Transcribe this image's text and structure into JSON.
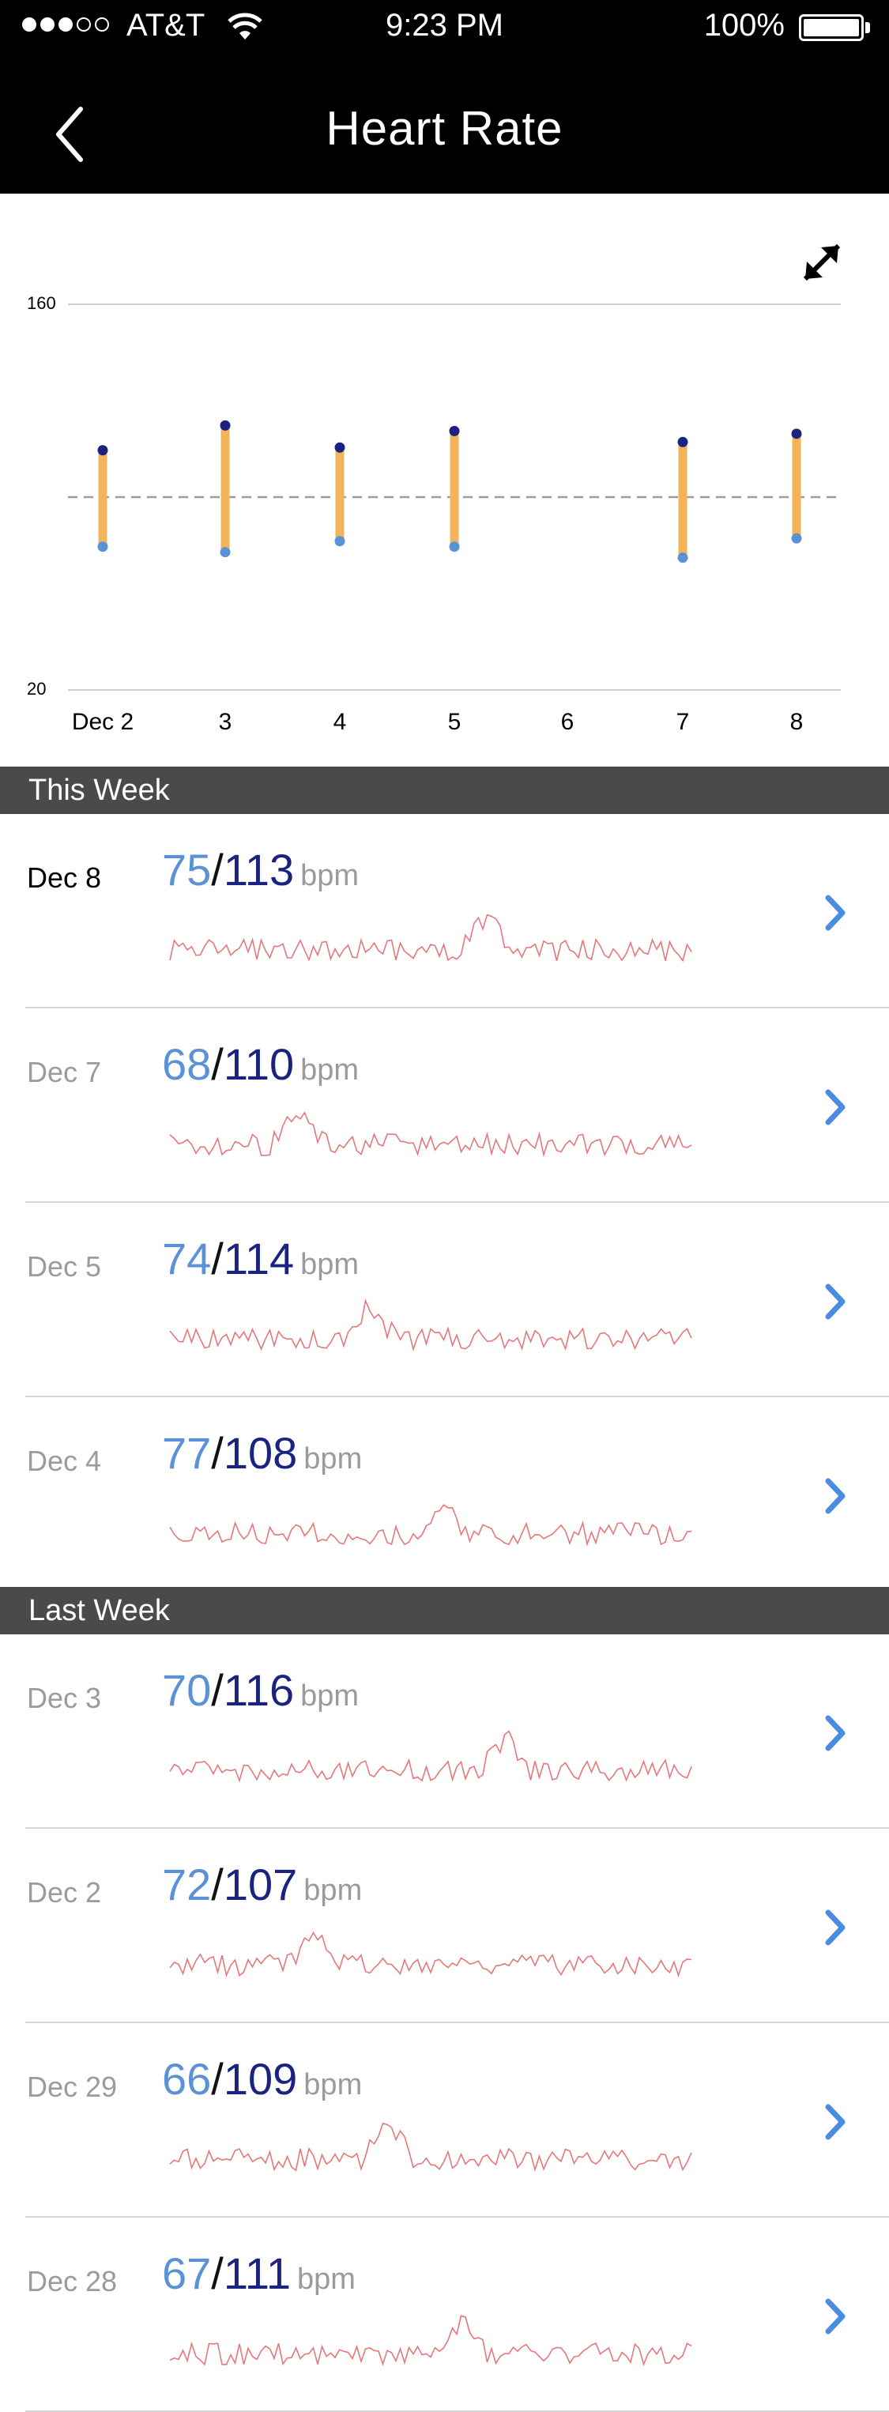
{
  "status_bar": {
    "carrier": "AT&T",
    "time": "9:23 PM",
    "battery": "100%"
  },
  "header": {
    "title": "Heart Rate"
  },
  "colors": {
    "bar": "#F2B35A",
    "high_dot": "#1A237E",
    "low_dot": "#5B92D6",
    "sparkline": "#E5787A",
    "section_bg": "#4A4A4A"
  },
  "chart_data": {
    "type": "range-bar",
    "ylim": [
      20,
      160
    ],
    "yticks": [
      "160",
      "20"
    ],
    "categories": [
      "Dec 2",
      "3",
      "4",
      "5",
      "6",
      "7",
      "8"
    ],
    "series": [
      {
        "name": "low",
        "values": [
          72,
          70,
          74,
          72,
          null,
          68,
          75
        ]
      },
      {
        "name": "high",
        "values": [
          107,
          116,
          108,
          114,
          null,
          110,
          113
        ]
      }
    ],
    "reference_line": 90,
    "grid": true
  },
  "sections": [
    {
      "title": "This Week",
      "rows": [
        {
          "date": "Dec 8",
          "low": "75",
          "high": "113",
          "unit": "bpm",
          "current": true
        },
        {
          "date": "Dec 7",
          "low": "68",
          "high": "110",
          "unit": "bpm",
          "current": false
        },
        {
          "date": "Dec 5",
          "low": "74",
          "high": "114",
          "unit": "bpm",
          "current": false
        },
        {
          "date": "Dec 4",
          "low": "77",
          "high": "108",
          "unit": "bpm",
          "current": false
        }
      ]
    },
    {
      "title": "Last Week",
      "rows": [
        {
          "date": "Dec 3",
          "low": "70",
          "high": "116",
          "unit": "bpm",
          "current": false
        },
        {
          "date": "Dec 2",
          "low": "72",
          "high": "107",
          "unit": "bpm",
          "current": false
        },
        {
          "date": "Dec 29",
          "low": "66",
          "high": "109",
          "unit": "bpm",
          "current": false
        },
        {
          "date": "Dec 28",
          "low": "67",
          "high": "111",
          "unit": "bpm",
          "current": false
        }
      ]
    }
  ]
}
